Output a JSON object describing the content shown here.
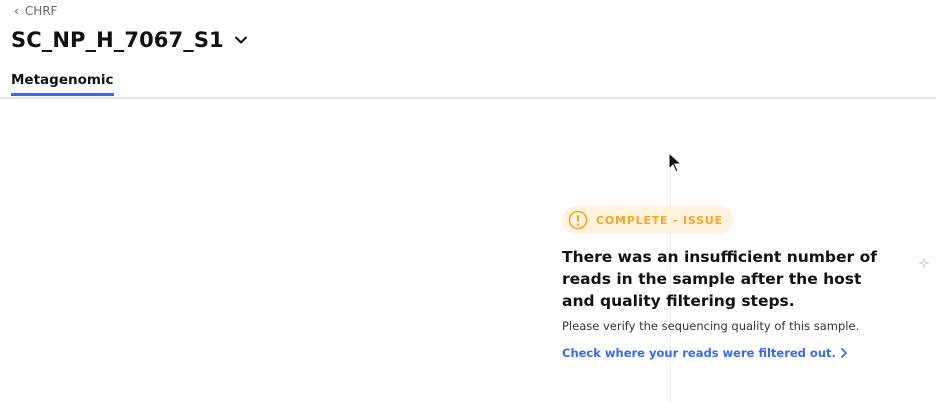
{
  "header": {
    "back_label": "CHRF",
    "sample_name": "SC_NP_H_7067_S1",
    "icons": {
      "back": "chevron-left-icon",
      "dropdown": "chevron-down-icon"
    }
  },
  "tabs": [
    {
      "label": "Metagenomic",
      "active": true
    }
  ],
  "status": {
    "badge_label": "COMPLETE - ISSUE",
    "badge_icon": "warning-circle-icon",
    "title": "There was an insufficient number of reads in the sample after the host and quality filtering steps.",
    "message": "Please verify the sequencing quality of this sample.",
    "link_label": "Check where your reads were filtered out.",
    "link_icon": "chevron-right-icon"
  },
  "colors": {
    "accent": "#3867fa",
    "warning": "#f5a623",
    "warning_bg": "#fff3e0"
  }
}
